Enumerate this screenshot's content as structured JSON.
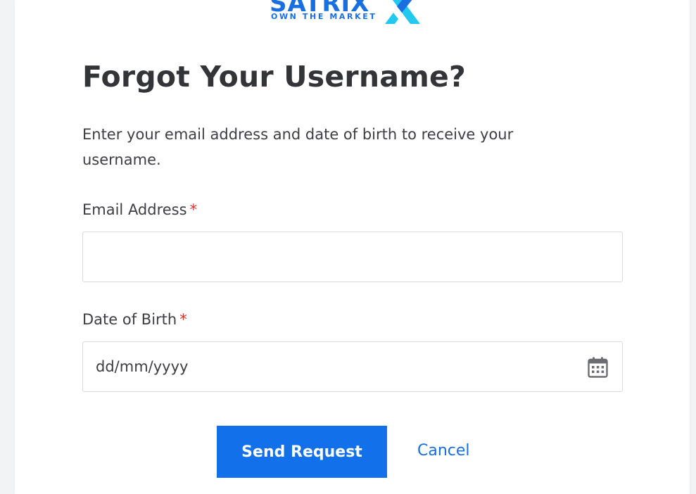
{
  "brand": {
    "name": "SATRIX",
    "tagline": "OWN THE MARKET",
    "logo_icon": "satrix-x-logo",
    "colors": {
      "blue": "#1a6fe0",
      "cyan": "#22c8ee"
    }
  },
  "page": {
    "title": "Forgot Your Username?",
    "description": "Enter your email address and date of birth to receive your username."
  },
  "form": {
    "email": {
      "label": "Email Address",
      "required_mark": "*",
      "value": "",
      "placeholder": ""
    },
    "dob": {
      "label": "Date of Birth",
      "required_mark": "*",
      "placeholder": "dd/mm/yyyy",
      "icon": "calendar-icon"
    }
  },
  "actions": {
    "send_label": "Send Request",
    "cancel_label": "Cancel",
    "primary_color": "#1170ea"
  }
}
